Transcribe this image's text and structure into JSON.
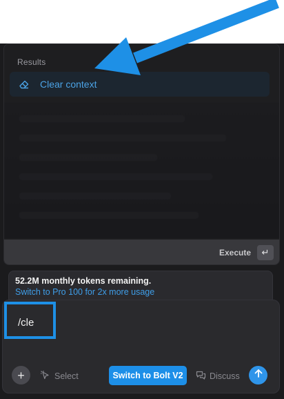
{
  "palette": {
    "results_heading": "Results",
    "results": [
      {
        "label": "Clear context",
        "icon": "eraser-icon"
      }
    ],
    "footer": {
      "execute_label": "Execute",
      "enter_key_glyph": "↵"
    }
  },
  "usage": {
    "tokens_text": "52.2M monthly tokens remaining.",
    "upgrade_link": "Switch to Pro 100 for 2x more usage"
  },
  "chat": {
    "input_value": "/cle",
    "toolbar": {
      "add_glyph": "+",
      "select_label": "Select",
      "switch_label": "Switch to Bolt V2",
      "discuss_label": "Discuss"
    }
  },
  "colors": {
    "accent": "#1d8fe8",
    "annotation": "#1e90e6",
    "link": "#3f9ee8"
  }
}
